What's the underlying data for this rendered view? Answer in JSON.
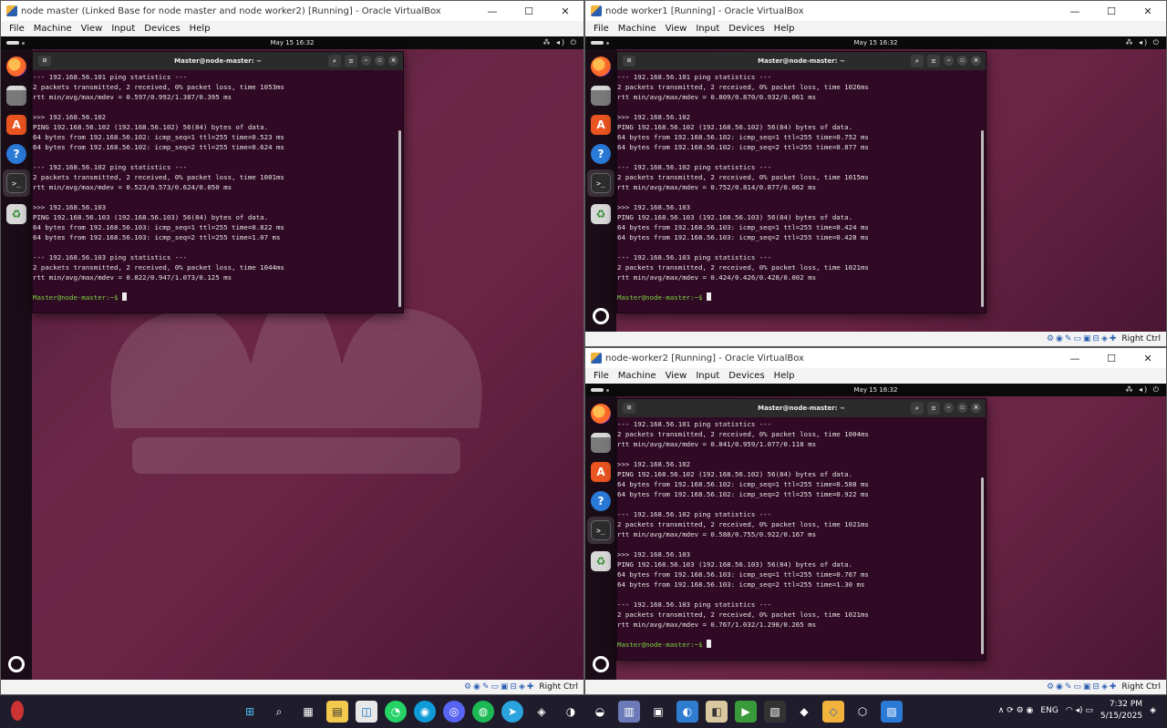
{
  "vm1": {
    "title": "node master (Linked Base for node master and node worker2) [Running] - Oracle VirtualBox",
    "clock": "May 15  16:32",
    "host_key": "Right Ctrl",
    "terminal_title": "Master@node-master: ~"
  },
  "vm2": {
    "title": "node worker1 [Running] - Oracle VirtualBox",
    "clock": "May 15  16:32",
    "host_key": "Right Ctrl",
    "terminal_title": "Master@node-master: ~"
  },
  "vm3": {
    "title": "node-worker2 [Running] - Oracle VirtualBox",
    "clock": "May 15  16:32",
    "host_key": "Right Ctrl",
    "terminal_title": "Master@node-master: ~"
  },
  "menu": {
    "file": "File",
    "machine": "Machine",
    "view": "View",
    "input": "Input",
    "devices": "Devices",
    "help": "Help"
  },
  "window_controls": {
    "minimize": "—",
    "maximize": "☐",
    "close": "✕"
  },
  "terminal_glyphs": {
    "newtab": "⊞",
    "search": "⌕",
    "menu": "≡",
    "min": "–",
    "max": "▫",
    "close": "×"
  },
  "dock_glyphs": {
    "help": "?",
    "term": ">_",
    "trash": "♻",
    "store": "A"
  },
  "gnome_tray": "⁂ ◂) ⏻",
  "status_icons": "⚙◉✎▭▣⊟◈✚",
  "taskbar_glyphs": [
    "⊞",
    "⌕",
    "▦",
    "▤",
    "◫",
    "◔",
    "◉",
    "◎",
    "◍",
    "➤",
    "◈",
    "◑",
    "◒",
    "▥",
    "▣",
    "◐",
    "◧",
    "▶",
    "▧",
    "◆",
    "◇",
    "⬡",
    "▨"
  ],
  "term1": {
    "lines": [
      "--- 192.168.56.101 ping statistics ---",
      "2 packets transmitted, 2 received, 0% packet loss, time 1053ms",
      "rtt min/avg/max/mdev = 0.597/0.992/1.387/0.395 ms",
      "",
      ">>> 192.168.56.102",
      "PING 192.168.56.102 (192.168.56.102) 56(84) bytes of data.",
      "64 bytes from 192.168.56.102: icmp_seq=1 ttl=255 time=0.523 ms",
      "64 bytes from 192.168.56.102: icmp_seq=2 ttl=255 time=0.624 ms",
      "",
      "--- 192.168.56.102 ping statistics ---",
      "2 packets transmitted, 2 received, 0% packet loss, time 1001ms",
      "rtt min/avg/max/mdev = 0.523/0.573/0.624/0.050 ms",
      "",
      ">>> 192.168.56.103",
      "PING 192.168.56.103 (192.168.56.103) 56(84) bytes of data.",
      "64 bytes from 192.168.56.103: icmp_seq=1 ttl=255 time=0.822 ms",
      "64 bytes from 192.168.56.103: icmp_seq=2 ttl=255 time=1.07 ms",
      "",
      "--- 192.168.56.103 ping statistics ---",
      "2 packets transmitted, 2 received, 0% packet loss, time 1044ms",
      "rtt min/avg/max/mdev = 0.822/0.947/1.073/0.125 ms",
      ""
    ],
    "prompt": "Master@node-master:~$ "
  },
  "term2": {
    "lines": [
      "--- 192.168.56.101 ping statistics ---",
      "2 packets transmitted, 2 received, 0% packet loss, time 1026ms",
      "rtt min/avg/max/mdev = 0.809/0.870/0.932/0.061 ms",
      "",
      ">>> 192.168.56.102",
      "PING 192.168.56.102 (192.168.56.102) 56(84) bytes of data.",
      "64 bytes from 192.168.56.102: icmp_seq=1 ttl=255 time=0.752 ms",
      "64 bytes from 192.168.56.102: icmp_seq=2 ttl=255 time=0.877 ms",
      "",
      "--- 192.168.56.102 ping statistics ---",
      "2 packets transmitted, 2 received, 0% packet loss, time 1015ms",
      "rtt min/avg/max/mdev = 0.752/0.814/0.877/0.062 ms",
      "",
      ">>> 192.168.56.103",
      "PING 192.168.56.103 (192.168.56.103) 56(84) bytes of data.",
      "64 bytes from 192.168.56.103: icmp_seq=1 ttl=255 time=0.424 ms",
      "64 bytes from 192.168.56.103: icmp_seq=2 ttl=255 time=0.428 ms",
      "",
      "--- 192.168.56.103 ping statistics ---",
      "2 packets transmitted, 2 received, 0% packet loss, time 1021ms",
      "rtt min/avg/max/mdev = 0.424/0.426/0.428/0.002 ms",
      ""
    ],
    "prompt": "Master@node-master:~$ "
  },
  "term3": {
    "lines": [
      "--- 192.168.56.101 ping statistics ---",
      "2 packets transmitted, 2 received, 0% packet loss, time 1004ms",
      "rtt min/avg/max/mdev = 0.841/0.959/1.077/0.118 ms",
      "",
      ">>> 192.168.56.102",
      "PING 192.168.56.102 (192.168.56.102) 56(84) bytes of data.",
      "64 bytes from 192.168.56.102: icmp_seq=1 ttl=255 time=0.588 ms",
      "64 bytes from 192.168.56.102: icmp_seq=2 ttl=255 time=0.922 ms",
      "",
      "--- 192.168.56.102 ping statistics ---",
      "2 packets transmitted, 2 received, 0% packet loss, time 1021ms",
      "rtt min/avg/max/mdev = 0.588/0.755/0.922/0.167 ms",
      "",
      ">>> 192.168.56.103",
      "PING 192.168.56.103 (192.168.56.103) 56(84) bytes of data.",
      "64 bytes from 192.168.56.103: icmp_seq=1 ttl=255 time=0.767 ms",
      "64 bytes from 192.168.56.103: icmp_seq=2 ttl=255 time=1.30 ms",
      "",
      "--- 192.168.56.103 ping statistics ---",
      "2 packets transmitted, 2 received, 0% packet loss, time 1021ms",
      "rtt min/avg/max/mdev = 0.767/1.032/1.298/0.265 ms",
      ""
    ],
    "prompt": "Master@node-master:~$ "
  },
  "taskbar": {
    "language": "ENG",
    "time": "7:32 PM",
    "date": "5/15/2025",
    "tray_glyphs": "∧  ⟳  ⚙  ◉",
    "net_glyphs": "◠ ◂) ▭",
    "bell": "◈"
  },
  "colors": {
    "terminal_bg": "#300a24",
    "prompt": "#78d340",
    "taskbar_bg": "#1f1c2c"
  }
}
